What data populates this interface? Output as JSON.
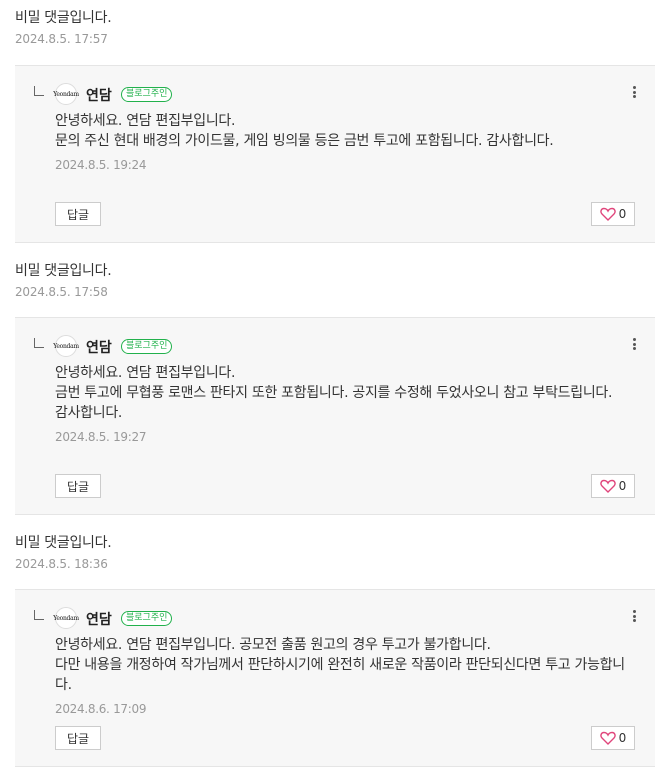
{
  "threads": [
    {
      "comment": {
        "text": "비밀 댓글입니다.",
        "date": "2024.8.5. 17:57"
      },
      "reply": {
        "avatar_text": "Yeondam",
        "author": "연담",
        "badge": "블로그주인",
        "lines": [
          "안녕하세요. 연담 편집부입니다.",
          "문의 주신 현대 배경의 가이드물, 게임 빙의물 등은 금번 투고에 포함됩니다. 감사합니다."
        ],
        "date": "2024.8.5. 19:24",
        "reply_label": "답글",
        "like_count": "0"
      }
    },
    {
      "comment": {
        "text": "비밀 댓글입니다.",
        "date": "2024.8.5. 17:58"
      },
      "reply": {
        "avatar_text": "Yeondam",
        "author": "연담",
        "badge": "블로그주인",
        "lines": [
          "안녕하세요. 연담 편집부입니다.",
          "금번 투고에 무협풍 로맨스 판타지 또한 포함됩니다. 공지를 수정해 두었사오니 참고 부탁드립니다.",
          "감사합니다."
        ],
        "date": "2024.8.5. 19:27",
        "reply_label": "답글",
        "like_count": "0"
      }
    },
    {
      "comment": {
        "text": "비밀 댓글입니다.",
        "date": "2024.8.5. 18:36"
      },
      "reply": {
        "avatar_text": "Yeondam",
        "author": "연담",
        "badge": "블로그주인",
        "lines": [
          "안녕하세요. 연담 편집부입니다. 공모전 출품 원고의 경우 투고가 불가합니다.",
          "다만 내용을 개정하여 작가님께서 판단하시기에 완전히 새로운 작품이라 판단되신다면 투고 가능합니다."
        ],
        "date": "2024.8.6. 17:09",
        "reply_label": "답글",
        "like_count": "0"
      }
    }
  ]
}
